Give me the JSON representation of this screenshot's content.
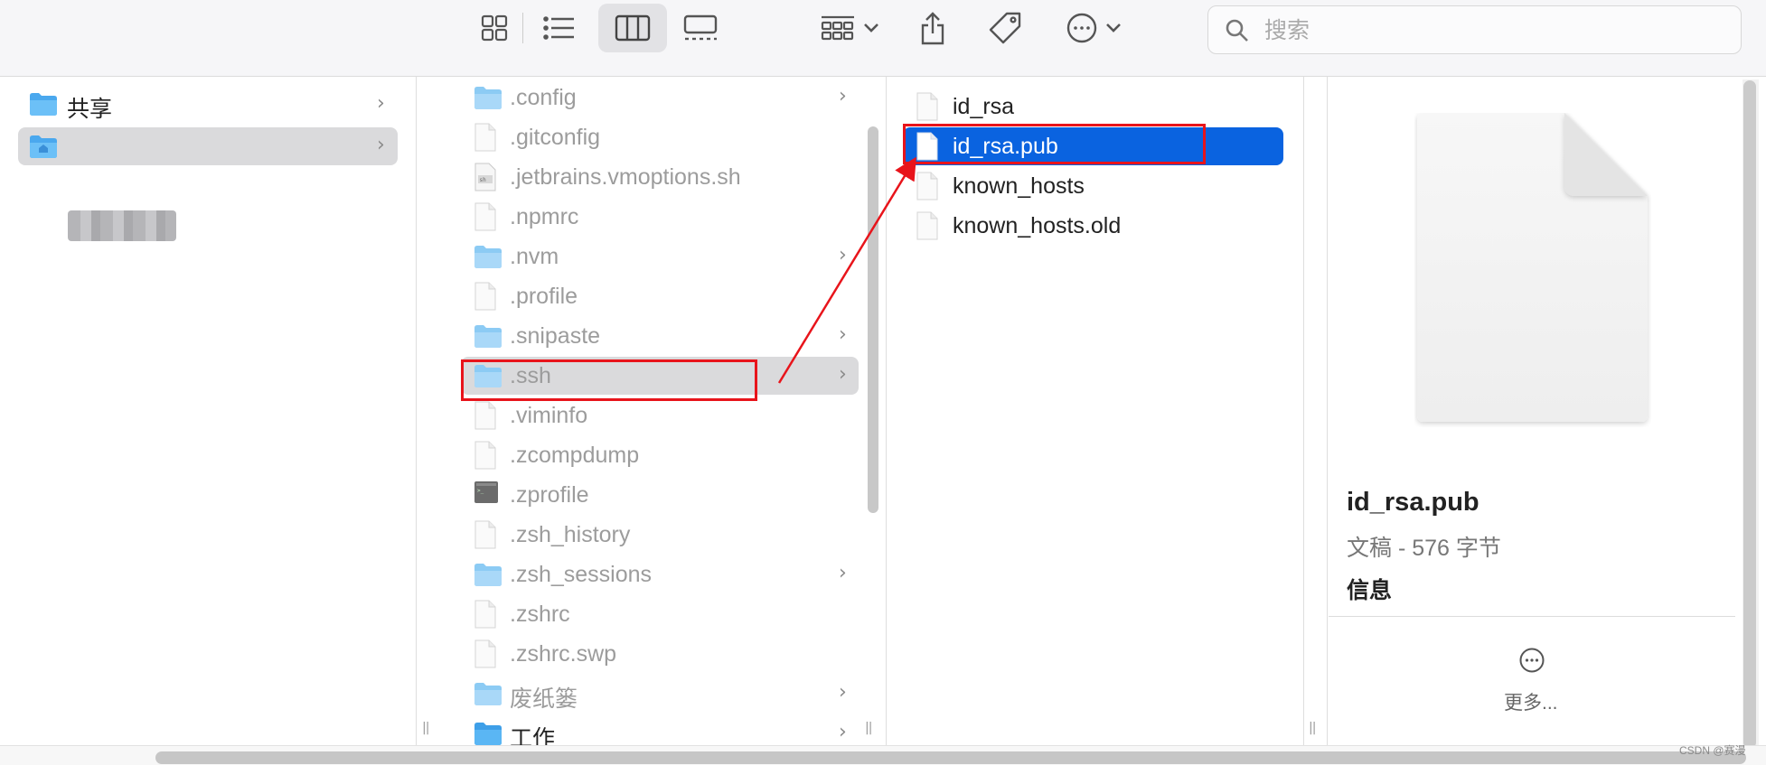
{
  "toolbar": {
    "search_placeholder": "搜索"
  },
  "sidebar": {
    "items": [
      {
        "label": "共享"
      },
      {
        "label": ""
      }
    ]
  },
  "home_column": {
    "items": [
      {
        "label": ".config",
        "type": "folder",
        "has_children": true
      },
      {
        "label": ".gitconfig",
        "type": "file"
      },
      {
        "label": ".jetbrains.vmoptions.sh",
        "type": "script"
      },
      {
        "label": ".npmrc",
        "type": "file"
      },
      {
        "label": ".nvm",
        "type": "folder",
        "has_children": true
      },
      {
        "label": ".profile",
        "type": "file"
      },
      {
        "label": ".snipaste",
        "type": "folder",
        "has_children": true
      },
      {
        "label": ".ssh",
        "type": "folder",
        "has_children": true
      },
      {
        "label": ".viminfo",
        "type": "file"
      },
      {
        "label": ".zcompdump",
        "type": "file"
      },
      {
        "label": ".zprofile",
        "type": "terminal"
      },
      {
        "label": ".zsh_history",
        "type": "file"
      },
      {
        "label": ".zsh_sessions",
        "type": "folder",
        "has_children": true
      },
      {
        "label": ".zshrc",
        "type": "file"
      },
      {
        "label": ".zshrc.swp",
        "type": "file"
      },
      {
        "label": "废纸篓",
        "type": "folder",
        "has_children": true
      },
      {
        "label": "工作",
        "type": "folder",
        "has_children": true
      }
    ]
  },
  "ssh_column": {
    "items": [
      {
        "label": "id_rsa"
      },
      {
        "label": "id_rsa.pub"
      },
      {
        "label": "known_hosts"
      },
      {
        "label": "known_hosts.old"
      }
    ]
  },
  "preview": {
    "name": "id_rsa.pub",
    "meta": "文稿 - 576 字节",
    "info_label": "信息",
    "more_label": "更多..."
  },
  "watermark": "CSDN @赛漫",
  "colors": {
    "selection_blue": "#0a63e0",
    "annotation_red": "#e8141b",
    "folder_blue": "#5bb4f0"
  }
}
